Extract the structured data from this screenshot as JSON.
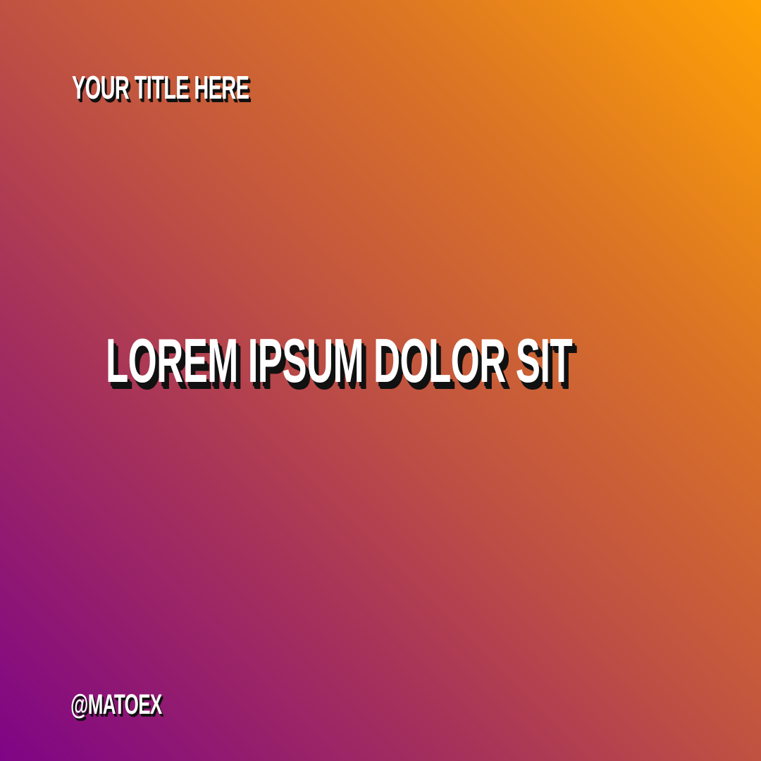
{
  "post": {
    "title": "YOUR TITLE HERE",
    "headline": "LOREM IPSUM DOLOR SIT",
    "handle": "@MATOEX"
  },
  "colors": {
    "gradient_start": "#7e0486",
    "gradient_mid": "#c2553f",
    "gradient_end": "#ffa304",
    "text": "#ffffff",
    "shadow": "#111111"
  }
}
